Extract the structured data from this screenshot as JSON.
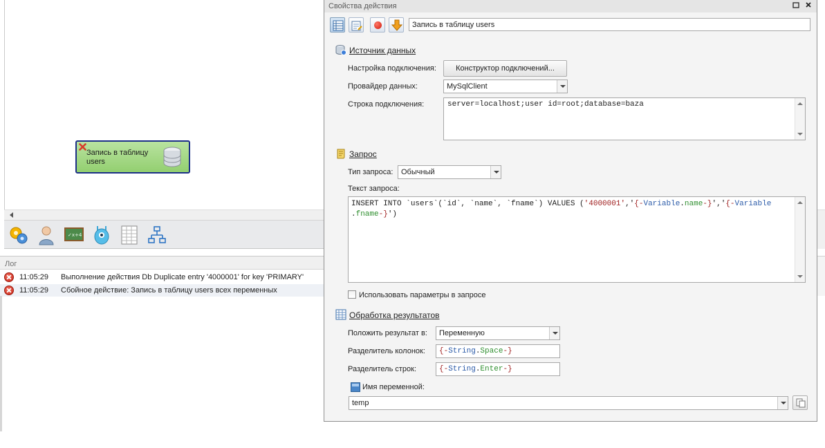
{
  "canvas": {
    "node": {
      "label_line1": "Запись в таблицу",
      "label_line2": "users"
    },
    "toolbar_icons": [
      "gear-cluster-icon",
      "user-icon",
      "chalkboard-icon",
      "robot-icon",
      "spreadsheet-icon",
      "hierarchy-icon"
    ]
  },
  "log": {
    "title": "Лог",
    "rows": [
      {
        "time": "11:05:29",
        "message": "Выполнение действия Db Duplicate entry '4000001' for key 'PRIMARY'"
      },
      {
        "time": "11:05:29",
        "message": "Сбойное действие: Запись в таблицу users всех переменных"
      }
    ]
  },
  "panel": {
    "title": "Свойства действия",
    "action_name": "Запись в таблицу users",
    "source": {
      "title": "Источник данных",
      "conn_setup_label": "Настройка подключения:",
      "conn_builder_button": "Конструктор подключений...",
      "provider_label": "Провайдер данных:",
      "provider_value": "MySqlClient",
      "conn_string_label": "Строка подключения:",
      "conn_string_value": "server=localhost;user id=root;database=baza"
    },
    "query": {
      "title": "Запрос",
      "type_label": "Тип запроса:",
      "type_value": "Обычный",
      "text_label": "Текст запроса:",
      "line1_a": "INSERT INTO `users`(`id`, `name`, `fname`) VALUES (",
      "line1_b": "'4000001'",
      "line1_c": ",'",
      "line1_d": "{-",
      "line1_e": "Variable",
      "line1_f": ".",
      "line1_g": "name",
      "line1_h": "-}",
      "line1_i": "','",
      "line1_j": "{-",
      "line1_k": "Variable",
      "line2_a": ".",
      "line2_b": "fname",
      "line2_c": "-}",
      "line2_d": "')",
      "use_params_label": "Использовать параметры в запросе"
    },
    "results": {
      "title": "Обработка результатов",
      "put_result_label": "Положить результат в:",
      "put_result_value": "Переменную",
      "col_sep_label": "Разделитель колонок:",
      "col_sep_brace_open": "{-",
      "col_sep_ns": "String",
      "col_sep_dot": ".",
      "col_sep_name": "Space",
      "col_sep_brace_close": "-}",
      "row_sep_label": "Разделитель строк:",
      "row_sep_brace_open": "{-",
      "row_sep_ns": "String",
      "row_sep_dot": ".",
      "row_sep_name": "Enter",
      "row_sep_brace_close": "-}",
      "var_name_label": "Имя переменной:",
      "var_name_value": "temp"
    }
  }
}
